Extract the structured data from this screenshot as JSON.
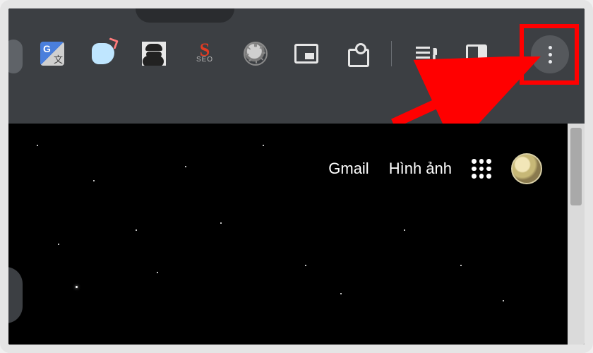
{
  "toolbar": {
    "extensions": [
      {
        "name": "google-translate",
        "label": "Google Translate"
      },
      {
        "name": "bird-cursor",
        "label": "Cursor Extension"
      },
      {
        "name": "incognito-spy",
        "label": "Privacy Extension"
      },
      {
        "name": "seo",
        "label": "SEO",
        "text_main": "S",
        "text_sub": "SEO"
      },
      {
        "name": "settings-gear",
        "label": "Settings"
      },
      {
        "name": "picture-in-picture",
        "label": "Picture in Picture"
      },
      {
        "name": "extensions-puzzle",
        "label": "Extensions"
      },
      {
        "name": "media-control",
        "label": "Media Controls"
      },
      {
        "name": "side-panel",
        "label": "Side Panel"
      }
    ],
    "menu_button": "Customize and control"
  },
  "page": {
    "links": {
      "gmail": "Gmail",
      "images": "Hình ảnh"
    },
    "apps_label": "Google apps",
    "avatar_label": "Account"
  },
  "annotation": {
    "highlight": "menu button highlight",
    "arrow_color": "#ff0000"
  }
}
